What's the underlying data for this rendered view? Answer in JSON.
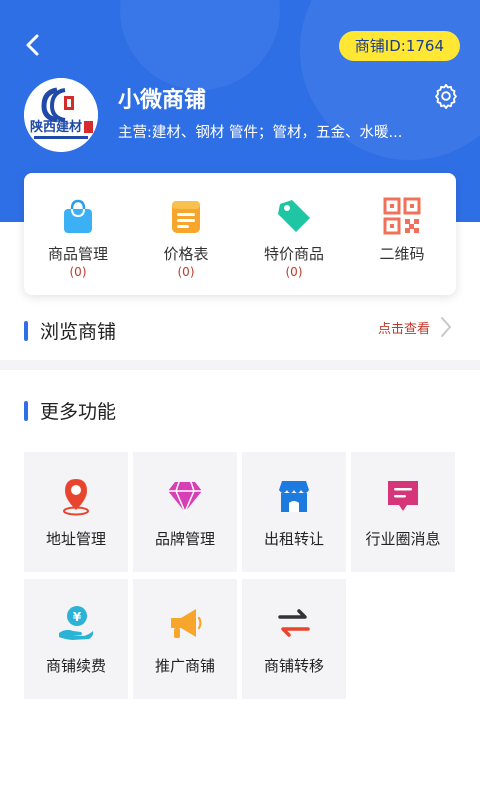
{
  "header": {
    "shop_id": "商铺ID:1764",
    "shop_name": "小微商铺",
    "shop_desc": "主营:建材、钢材 管件；管材，五金、水暖...",
    "logo_text": "陕西建材"
  },
  "quick_actions": [
    {
      "label": "商品管理",
      "count": "(0)",
      "icon": "shopping-bag-icon"
    },
    {
      "label": "价格表",
      "count": "(0)",
      "icon": "price-list-icon"
    },
    {
      "label": "特价商品",
      "count": "(0)",
      "icon": "price-tag-icon"
    },
    {
      "label": "二维码",
      "icon": "qr-code-icon"
    }
  ],
  "browse": {
    "title": "浏览商铺",
    "link": "点击查看"
  },
  "more": {
    "title": "更多功能",
    "items": [
      {
        "label": "地址管理",
        "icon": "location-pin-icon"
      },
      {
        "label": "品牌管理",
        "icon": "diamond-icon"
      },
      {
        "label": "出租转让",
        "icon": "storefront-icon"
      },
      {
        "label": "行业圈消息",
        "icon": "message-icon"
      },
      {
        "label": "商铺续费",
        "icon": "money-hand-icon"
      },
      {
        "label": "推广商铺",
        "icon": "megaphone-icon"
      },
      {
        "label": "商铺转移",
        "icon": "transfer-arrows-icon"
      }
    ]
  },
  "colors": {
    "primary": "#2f6fe6",
    "id_badge": "#ffe733",
    "accent_red": "#c0392b"
  }
}
